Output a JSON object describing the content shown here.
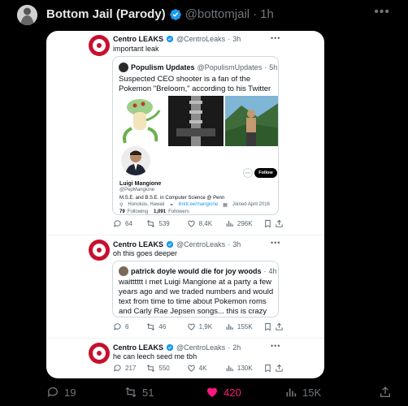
{
  "outer_tweet": {
    "display_name": "Bottom Jail (Parody)",
    "handle": "@bottomjail",
    "separator": "·",
    "time": "1h",
    "actions": {
      "replies": "19",
      "reposts": "51",
      "likes": "420",
      "views": "15K"
    }
  },
  "screenshot": {
    "tweets": [
      {
        "display_name": "Centro LEAKS",
        "handle": "@CentroLeaks",
        "separator": "·",
        "time": "3h",
        "text": "important leak",
        "quote": {
          "display_name": "Populism Updates",
          "handle": "@PopulismUpdates",
          "separator": "·",
          "time": "5h",
          "text": "Suspected CEO shooter is a fan of the Pokemon \"Breloom,\" according to his Twitter",
          "profile": {
            "name": "Luigi Mangione",
            "handle": "@PepMangione",
            "bio": "M.S.E. and B.S.E. in Computer Science @ Penn",
            "location": "Honolulu, Hawaii",
            "link": "linktr.ee/mangione",
            "joined": "Joined April 2016",
            "following_count": "79",
            "following_label": "Following",
            "followers_count": "1,091",
            "followers_label": "Followers",
            "follow_label": "Follow"
          }
        },
        "actions": {
          "replies": "64",
          "reposts": "539",
          "likes": "8,4K",
          "views": "296K"
        }
      },
      {
        "display_name": "Centro LEAKS",
        "handle": "@CentroLeaks",
        "separator": "·",
        "time": "3h",
        "text": "oh this goes deeper",
        "quote": {
          "display_name": "patrick doyle would die for joy woods",
          "separator": "·",
          "time": "4h",
          "text": "waitttttt i met Luigi Mangione at a party a few years ago and we traded numbers and would text from time to time about Pokemon roms and Carly Rae Jepsen songs... this is crazy"
        },
        "actions": {
          "replies": "6",
          "reposts": "46",
          "likes": "1,9K",
          "views": "155K"
        }
      },
      {
        "display_name": "Centro LEAKS",
        "handle": "@CentroLeaks",
        "separator": "·",
        "time": "2h",
        "text": "he can leech seed me tbh",
        "actions": {
          "replies": "217",
          "reposts": "550",
          "likes": "4K",
          "views": "130K"
        }
      }
    ]
  },
  "colors": {
    "background": "#000000",
    "card": "#ffffff",
    "verified": "#1d9bf0",
    "like_active": "#f91880",
    "centro_red": "#c8102e"
  }
}
